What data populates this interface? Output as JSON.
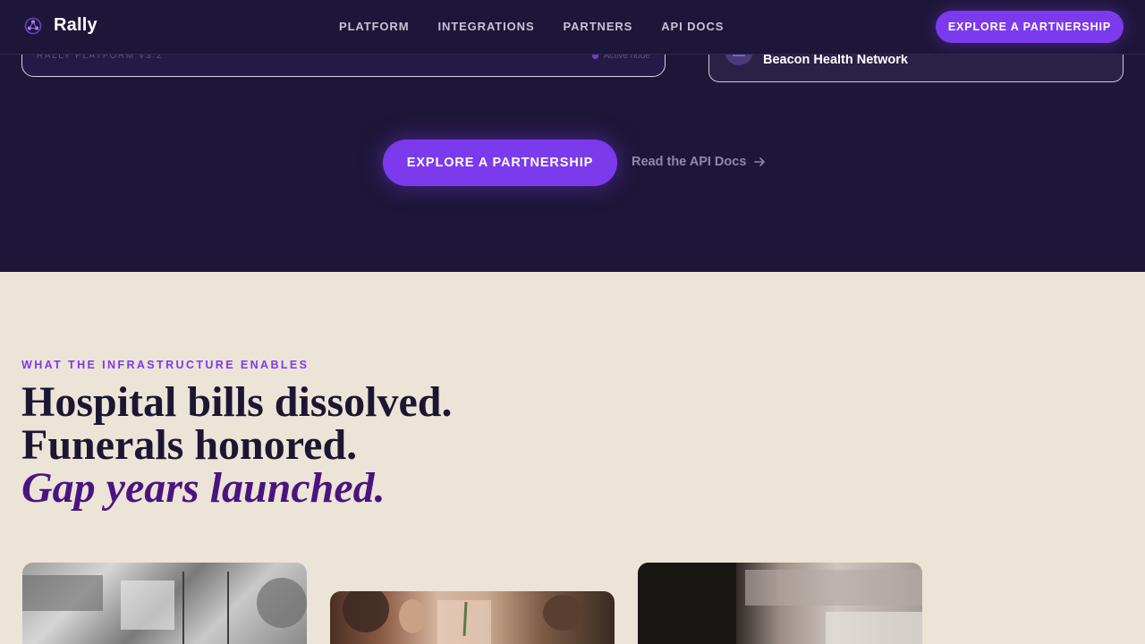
{
  "nav": {
    "brand": "Rally",
    "links": [
      "PLATFORM",
      "INTEGRATIONS",
      "PARTNERS",
      "API DOCS"
    ],
    "cta": "EXPLORE A PARTNERSHIP"
  },
  "hero": {
    "platform_card": {
      "label": "RALLY PLATFORM V3.2",
      "status": "Active node"
    },
    "partner_card": {
      "name": "Beacon Health Network"
    },
    "cta": "EXPLORE A PARTNERSHIP",
    "secondary_link": "Read the API Docs"
  },
  "section": {
    "eyebrow": "WHAT THE INFRASTRUCTURE ENABLES",
    "headline": [
      "Hospital bills dissolved.",
      "Funerals honored.",
      "Gap years launched."
    ]
  },
  "colors": {
    "dark_bg": "#1e1638",
    "accent": "#7c3aed",
    "cream_bg": "#ece4d6",
    "headline_text": "#1c1633",
    "headline_em": "#4a1480"
  },
  "icons": {
    "brand": "network-logo-icon",
    "partner": "building-icon",
    "link_arrow": "arrow-right-icon"
  }
}
